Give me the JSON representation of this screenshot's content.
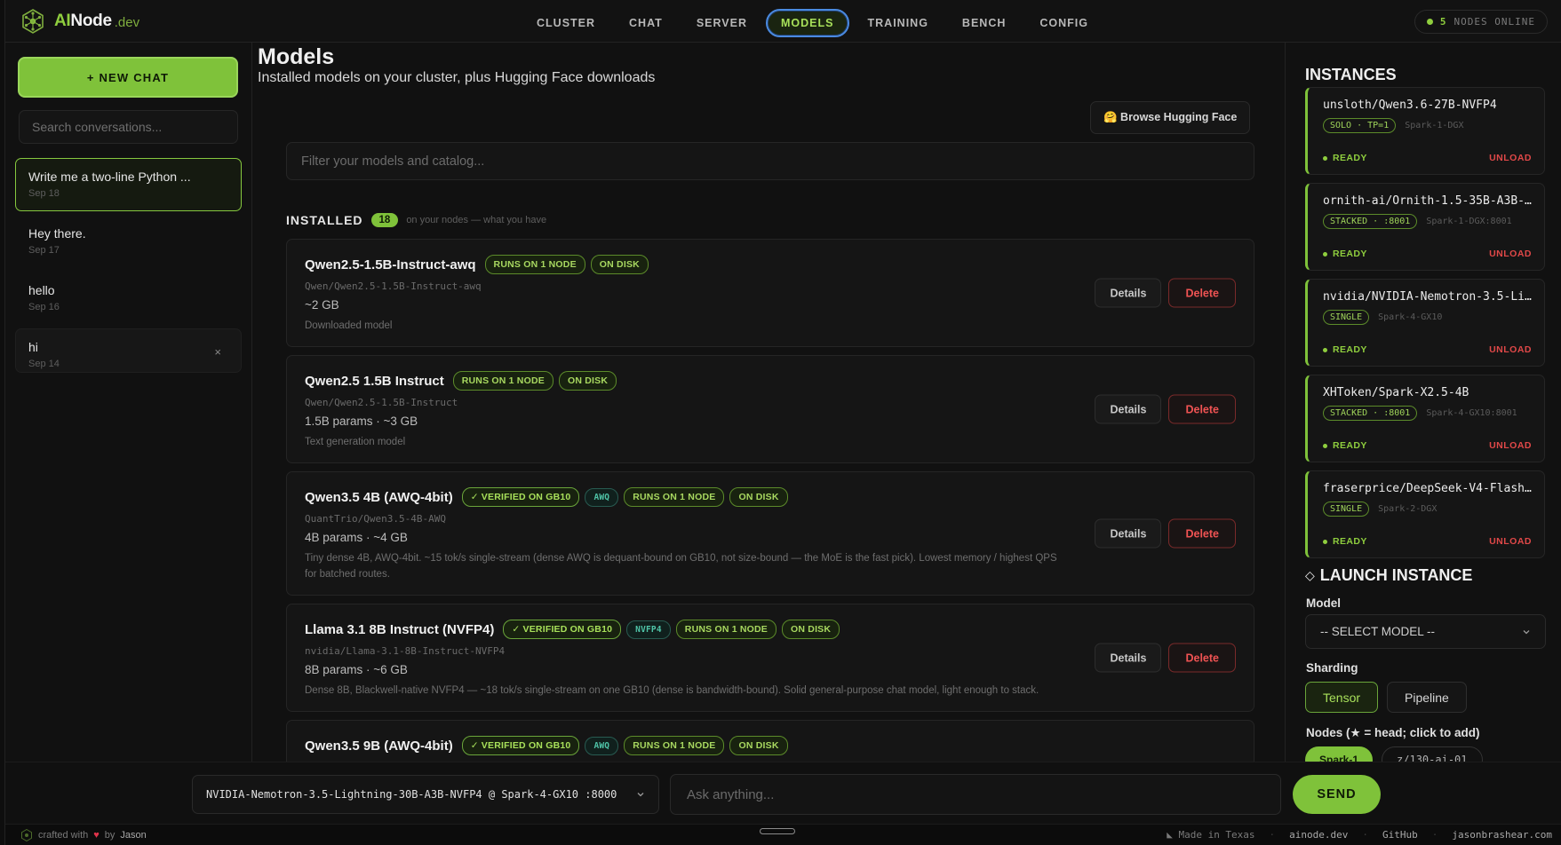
{
  "brand": {
    "prefix": "AI",
    "name": "Node",
    "tld": ".dev"
  },
  "nav": {
    "items": [
      {
        "label": "CLUSTER"
      },
      {
        "label": "CHAT"
      },
      {
        "label": "SERVER"
      },
      {
        "label": "MODELS",
        "active": true
      },
      {
        "label": "TRAINING"
      },
      {
        "label": "BENCH"
      },
      {
        "label": "CONFIG"
      }
    ],
    "nodes_count": "5",
    "nodes_label": "NODES ONLINE"
  },
  "sidebar": {
    "new_chat_label": "+ NEW CHAT",
    "search_placeholder": "Search conversations...",
    "conversations": [
      {
        "title": "Write me a two-line Python ...",
        "date": "Sep 18"
      },
      {
        "title": "Hey there.",
        "date": "Sep 17"
      },
      {
        "title": "hello",
        "date": "Sep 16"
      },
      {
        "title": "hi",
        "date": "Sep 14",
        "close": "×"
      }
    ]
  },
  "main": {
    "title": "Models",
    "subtitle": "Installed models on your cluster, plus Hugging Face downloads",
    "browse_label": "🤗 Browse Hugging Face",
    "filter_placeholder": "Filter your models and catalog...",
    "installed_label": "INSTALLED",
    "installed_count": "18",
    "installed_hint": "on your nodes — what you have",
    "details_label": "Details",
    "delete_label": "Delete",
    "models": [
      {
        "name": "Qwen2.5-1.5B-Instruct-awq",
        "tags": [
          {
            "text": "RUNS ON 1 NODE",
            "kind": "plain"
          },
          {
            "text": "ON DISK",
            "kind": "plain"
          }
        ],
        "repo": "Qwen/Qwen2.5-1.5B-Instruct-awq",
        "size": "~2 GB",
        "desc": "Downloaded model"
      },
      {
        "name": "Qwen2.5 1.5B Instruct",
        "tags": [
          {
            "text": "RUNS ON 1 NODE",
            "kind": "plain"
          },
          {
            "text": "ON DISK",
            "kind": "plain"
          }
        ],
        "repo": "Qwen/Qwen2.5-1.5B-Instruct",
        "size": "1.5B params · ~3 GB",
        "desc": "Text generation model"
      },
      {
        "name": "Qwen3.5 4B (AWQ-4bit)",
        "tags": [
          {
            "text": "✓ VERIFIED ON GB10",
            "kind": "verified"
          },
          {
            "text": "AWQ",
            "kind": "fmt"
          },
          {
            "text": "RUNS ON 1 NODE",
            "kind": "plain"
          },
          {
            "text": "ON DISK",
            "kind": "plain"
          }
        ],
        "repo": "QuantTrio/Qwen3.5-4B-AWQ",
        "size": "4B params · ~4 GB",
        "desc": "Tiny dense 4B, AWQ-4bit. ~15 tok/s single-stream (dense AWQ is dequant-bound on GB10, not size-bound — the MoE is the fast pick). Lowest memory / highest QPS for batched routes."
      },
      {
        "name": "Llama 3.1 8B Instruct (NVFP4)",
        "tags": [
          {
            "text": "✓ VERIFIED ON GB10",
            "kind": "verified"
          },
          {
            "text": "NVFP4",
            "kind": "fmt"
          },
          {
            "text": "RUNS ON 1 NODE",
            "kind": "plain"
          },
          {
            "text": "ON DISK",
            "kind": "plain"
          }
        ],
        "repo": "nvidia/Llama-3.1-8B-Instruct-NVFP4",
        "size": "8B params · ~6 GB",
        "desc": "Dense 8B, Blackwell-native NVFP4 — ~18 tok/s single-stream on one GB10 (dense is bandwidth-bound). Solid general-purpose chat model, light enough to stack."
      },
      {
        "name": "Qwen3.5 9B (AWQ-4bit)",
        "tags": [
          {
            "text": "✓ VERIFIED ON GB10",
            "kind": "verified"
          },
          {
            "text": "AWQ",
            "kind": "fmt"
          },
          {
            "text": "RUNS ON 1 NODE",
            "kind": "plain"
          },
          {
            "text": "ON DISK",
            "kind": "plain"
          }
        ],
        "repo": "",
        "size": "",
        "desc": ""
      }
    ]
  },
  "instances": {
    "title": "INSTANCES",
    "ready_label": "READY",
    "unload_label": "UNLOAD",
    "items": [
      {
        "name": "unsloth/Qwen3.6-27B-NVFP4",
        "tag": "SOLO · TP=1",
        "node": "Spark-1-DGX"
      },
      {
        "name": "ornith-ai/Ornith-1.5-35B-A3B-...",
        "tag": "STACKED · :8001",
        "node": "Spark-1-DGX:8001"
      },
      {
        "name": "nvidia/NVIDIA-Nemotron-3.5-Li...",
        "tag": "SINGLE",
        "node": "Spark-4-GX10"
      },
      {
        "name": "XHToken/Spark-X2.5-4B",
        "tag": "STACKED · :8001",
        "node": "Spark-4-GX10:8001"
      },
      {
        "name": "fraserprice/DeepSeek-V4-Flash...",
        "tag": "SINGLE",
        "node": "Spark-2-DGX"
      }
    ]
  },
  "launch": {
    "title": "LAUNCH INSTANCE",
    "icon": "◇",
    "model_label": "Model",
    "model_value": "-- SELECT MODEL --",
    "sharding_label": "Sharding",
    "sharding_options": [
      "Tensor",
      "Pipeline"
    ],
    "nodes_label": "Nodes (★ = head; click to add)",
    "node_chips": [
      "Spark-1",
      "z/130-ai-01"
    ]
  },
  "composer": {
    "model": "NVIDIA-Nemotron-3.5-Lightning-30B-A3B-NVFP4 @ Spark-4-GX10 :8000",
    "ask_placeholder": "Ask anything...",
    "send_label": "SEND"
  },
  "footer": {
    "crafted": "crafted with",
    "heart": "♥",
    "by": "by",
    "author": "Jason",
    "made_in": "Made in Texas",
    "links": [
      "ainode.dev",
      "GitHub",
      "jasonbrashear.com"
    ]
  },
  "colors": {
    "accent": "#7fc23a",
    "danger": "#e04848",
    "bg": "#111111",
    "nav_active_ring": "#4a8ae0"
  }
}
